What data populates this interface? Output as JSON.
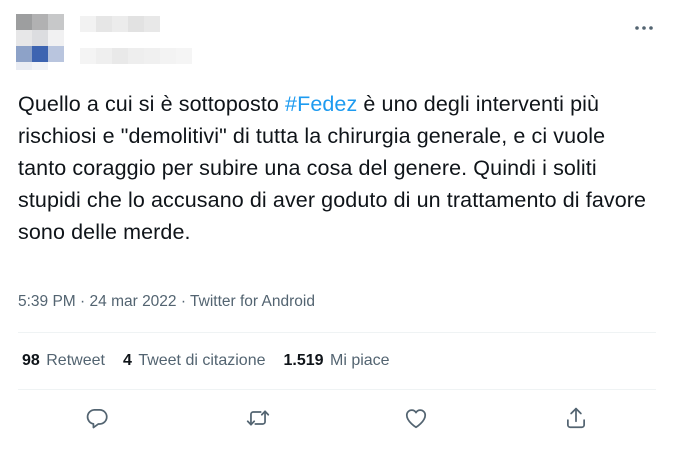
{
  "tweet": {
    "text_before": "Quello a cui si è sottoposto ",
    "hashtag": "#Fedez",
    "text_after": " è uno degli interventi più rischiosi e \"demolitivi\" di tutta la chirurgia generale, e ci vuole tanto coraggio per subire una cosa del genere. Quindi i soliti stupidi che lo accusano di aver goduto di un trattamento di favore sono delle merde."
  },
  "meta": {
    "time": "5:39 PM",
    "separator": " · ",
    "date": "24 mar 2022",
    "source": "Twitter for Android"
  },
  "stats": {
    "retweets": {
      "count": "98",
      "label": "Retweet"
    },
    "quotes": {
      "count": "4",
      "label": "Tweet di citazione"
    },
    "likes": {
      "count": "1.519",
      "label": "Mi piace"
    }
  },
  "icons": {
    "more": "more-horizontal-icon",
    "reply": "reply-icon",
    "retweet": "retweet-icon",
    "like": "heart-icon",
    "share": "share-icon"
  },
  "colors": {
    "text": "#0f1419",
    "secondary": "#536471",
    "hashtag": "#1d9bf0",
    "divider": "#eff3f4"
  }
}
